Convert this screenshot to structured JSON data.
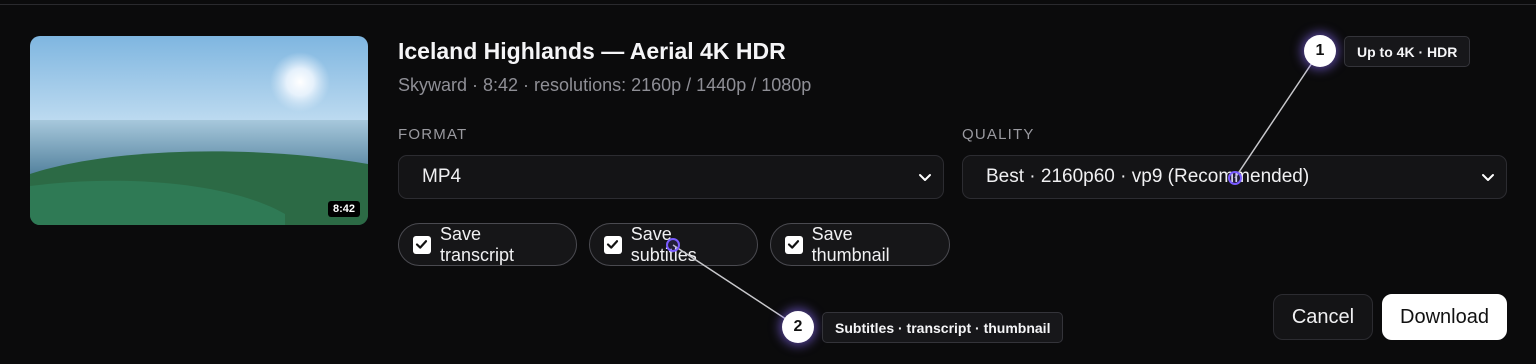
{
  "video": {
    "title": "Iceland Highlands — Aerial 4K HDR",
    "meta": "Skyward · 8:42 · resolutions: 2160p / 1440p / 1080p",
    "duration": "8:42"
  },
  "format": {
    "label": "FORMAT",
    "value": "MP4"
  },
  "quality": {
    "label": "QUALITY",
    "value": "Best · 2160p60 · vp9 (Recommended)"
  },
  "options": {
    "transcript": {
      "label": "Save transcript",
      "checked": true
    },
    "subtitles": {
      "label": "Save subtitles",
      "checked": true
    },
    "thumbnail": {
      "label": "Save thumbnail",
      "checked": true
    }
  },
  "actions": {
    "cancel": "Cancel",
    "download": "Download"
  },
  "annotations": [
    {
      "number": "1",
      "text": "Up to 4K · HDR"
    },
    {
      "number": "2",
      "text": "Subtitles · transcript · thumbnail"
    }
  ],
  "colors": {
    "background": "#0b0b0c",
    "accent": "#7a5cff",
    "field_bg": "#141416"
  }
}
